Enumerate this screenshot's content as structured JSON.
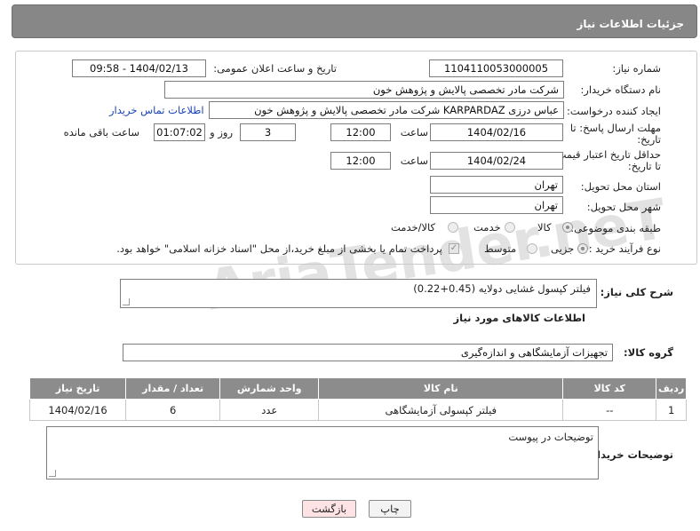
{
  "header": {
    "title": "جزئیات اطلاعات نیاز"
  },
  "watermark": "AriaTender.neT",
  "fields": {
    "need_number_label": "شماره نیاز:",
    "need_number": "1104110053000005",
    "announce_label": "تاریخ و ساعت اعلان عمومی:",
    "announce_value": "1404/02/13 - 09:58",
    "buyer_org_label": "نام دستگاه خریدار:",
    "buyer_org": "شرکت مادر تخصصی پالایش و پژوهش خون",
    "creator_label": "ایجاد کننده درخواست:",
    "creator": "عباس درزی KARPARDAZ شرکت مادر تخصصی پالایش و پژوهش خون",
    "contact_link": "اطلاعات تماس خریدار",
    "deadline_label": "مهلت ارسال پاسخ: تا تاریخ:",
    "deadline_date": "1404/02/16",
    "time_label": "ساعت",
    "deadline_time": "12:00",
    "days_value": "3",
    "days_label": "روز و",
    "remaining_value": "01:07:02",
    "remaining_label": "ساعت باقی مانده",
    "validity_label": "حداقل تاریخ اعتبار قیمت: تا تاریخ:",
    "validity_date": "1404/02/24",
    "validity_time": "12:00",
    "province_label": "استان محل تحویل:",
    "province": "تهران",
    "city_label": "شهر محل تحویل:",
    "city": "تهران",
    "category_label": "طبقه بندی موضوعی:",
    "category_options": [
      "کالا",
      "خدمت",
      "کالا/خدمت"
    ],
    "process_label": "نوع فرآیند خرید :",
    "process_options": [
      "جزیی",
      "متوسط"
    ],
    "payment_note": "پرداخت تمام یا بخشی از مبلغ خرید،از محل \"اسناد خزانه اسلامی\" خواهد بود."
  },
  "description": {
    "label": "شرح کلی نیاز:",
    "value": "فیلتر کپسول غشایی دولایه (0.45+0.22)"
  },
  "items_section": {
    "title": "اطلاعات کالاهای مورد نیاز",
    "group_label": "گروه کالا:",
    "group_value": "تجهیزات آزمایشگاهی و اندازه‌گیری",
    "columns": [
      "ردیف",
      "کد کالا",
      "نام کالا",
      "واحد شمارش",
      "تعداد / مقدار",
      "تاریخ نیاز"
    ],
    "rows": [
      {
        "row": "1",
        "code": "--",
        "name": "فیلتر کپسولی آزمایشگاهی",
        "unit": "عدد",
        "qty": "6",
        "date": "1404/02/16"
      }
    ]
  },
  "buyer_notes": {
    "label": "توضیحات خریدار:",
    "value": "توضیحات در پیوست"
  },
  "buttons": {
    "print": "چاپ",
    "back": "بازگشت"
  },
  "colors": {
    "titlebar": "#878787",
    "table_header": "#8c8c8c",
    "link": "#1a44b8",
    "back_button": "#fde3e3"
  }
}
